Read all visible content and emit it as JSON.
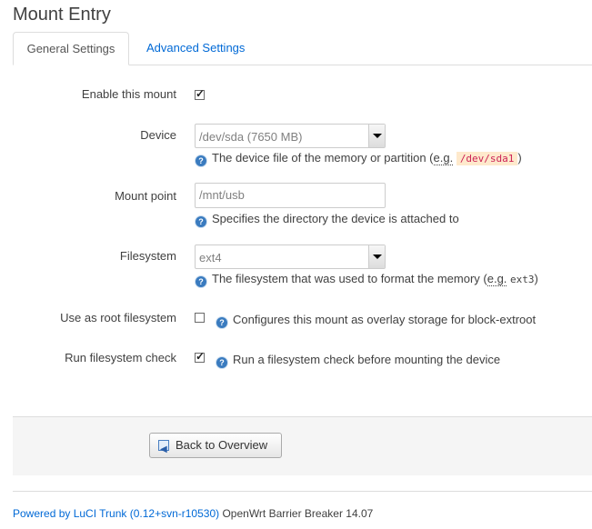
{
  "title": "Mount Entry",
  "tabs": [
    {
      "label": "General Settings",
      "active": true
    },
    {
      "label": "Advanced Settings",
      "active": false
    }
  ],
  "fields": {
    "enable": {
      "label": "Enable this mount",
      "checked": true
    },
    "device": {
      "label": "Device",
      "value": "/dev/sda (7650 MB)",
      "help_prefix": "The device file of the memory or partition (",
      "help_eg": "e.g.",
      "help_code": "/dev/sda1",
      "help_suffix": ")"
    },
    "mount_point": {
      "label": "Mount point",
      "placeholder": "/mnt/usb",
      "help": "Specifies the directory the device is attached to"
    },
    "filesystem": {
      "label": "Filesystem",
      "value": "ext4",
      "help_prefix": "The filesystem that was used to format the memory (",
      "help_eg": "e.g.",
      "help_code": "ext3",
      "help_suffix": ")"
    },
    "root_fs": {
      "label": "Use as root filesystem",
      "checked": false,
      "help": "Configures this mount as overlay storage for block-extroot"
    },
    "fs_check": {
      "label": "Run filesystem check",
      "checked": true,
      "help": "Run a filesystem check before mounting the device"
    }
  },
  "actions": {
    "back_label": "Back to Overview"
  },
  "footer": {
    "link_text": "Powered by LuCI Trunk (0.12+svn-r10530)",
    "text": " OpenWrt Barrier Breaker 14.07"
  },
  "colors": {
    "link": "#0069d6",
    "help_icon": "#3a7bbf",
    "code_bg": "#fee9cc"
  }
}
